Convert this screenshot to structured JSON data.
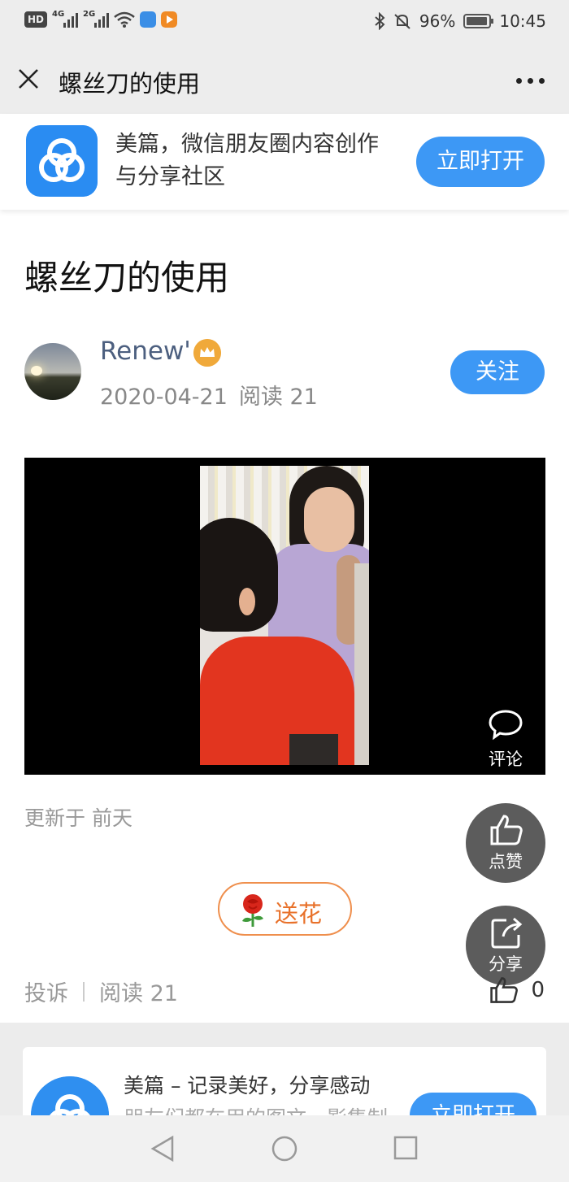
{
  "status_bar": {
    "left_badge": "HD",
    "sim1_label": "4G",
    "sim2_label": "2G",
    "battery_percent": "96%",
    "battery_level": 0.96,
    "time": "10:45",
    "icons": [
      "hd-icon",
      "signal-icon",
      "wifi-icon",
      "app-notification-icon",
      "video-app-icon",
      "bluetooth-icon",
      "mute-bell-icon",
      "battery-icon"
    ]
  },
  "nav": {
    "title": "螺丝刀的使用",
    "close_icon": "close-icon",
    "more_icon": "more-dots-icon"
  },
  "banner": {
    "text": "美篇，微信朋友圈内容创作与分享社区",
    "open_button": "立即打开"
  },
  "article": {
    "title": "螺丝刀的使用",
    "author": "Renew'",
    "date": "2020-04-21",
    "reads": "阅读 21",
    "follow_button": "关注",
    "updated": "更新于 前天"
  },
  "actions": {
    "comment": "评论",
    "like": "点赞",
    "share": "分享",
    "flower_button": "送花"
  },
  "footer": {
    "report": "投诉",
    "reads": "阅读 21",
    "like_count": "0"
  },
  "bottom_card": {
    "title": "美篇 – 记录美好，分享感动",
    "subtitle": "朋友们都在用的图文、影集制",
    "open_button": "立即打开"
  },
  "colors": {
    "accent_blue": "#3d98f5",
    "flower_orange": "#e8712a",
    "status_bg": "#ededed"
  }
}
